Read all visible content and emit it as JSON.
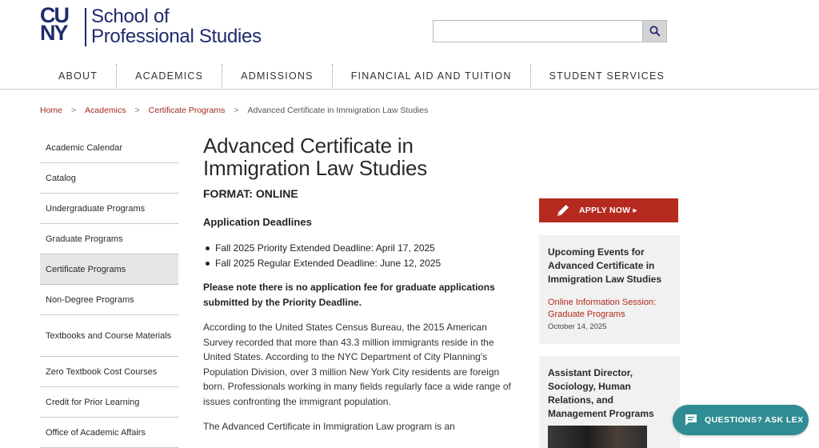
{
  "logo": {
    "mark_line1": "CU",
    "mark_line2": "NY",
    "text_line1": "School of",
    "text_line2": "Professional Studies"
  },
  "search": {
    "placeholder": "",
    "button_icon": "search-icon"
  },
  "nav": {
    "items": [
      "ABOUT",
      "ACADEMICS",
      "ADMISSIONS",
      "FINANCIAL AID AND TUITION",
      "STUDENT SERVICES"
    ]
  },
  "breadcrumb": {
    "items": [
      "Home",
      "Academics",
      "Certificate Programs"
    ],
    "current": "Advanced Certificate in Immigration Law Studies",
    "separator": ">"
  },
  "sidebar": {
    "items": [
      "Academic Calendar",
      "Catalog",
      "Undergraduate Programs",
      "Graduate Programs",
      "Certificate Programs",
      "Non-Degree Programs",
      "Textbooks and Course Materials",
      "Zero Textbook Cost Courses",
      "Credit for Prior Learning",
      "Office of Academic Affairs"
    ],
    "active_index": 4
  },
  "main": {
    "title": "Advanced Certificate in Immigration Law Studies",
    "format": "FORMAT: ONLINE",
    "deadlines_heading": "Application Deadlines",
    "deadlines": [
      "Fall 2025 Priority Extended Deadline: April 17, 2025",
      "Fall 2025 Regular Extended Deadline: June 12, 2025"
    ],
    "note": "Please note there is no application fee for graduate applications submitted by the Priority Deadline.",
    "paragraph1": "According to the United States Census Bureau, the 2015 American Survey recorded that more than 43.3 million immigrants reside in the United States. According to the NYC Department of City Planning's Population Division, over 3 million New York City residents are foreign born. Professionals working in many fields regularly face a wide range of issues confronting the immigrant population.",
    "paragraph2": "The Advanced Certificate in Immigration Law program is an"
  },
  "apply": {
    "label": "APPLY NOW ▸",
    "icon": "pencil-icon"
  },
  "events": {
    "title": "Upcoming Events for Advanced Certificate in Immigration Law Studies",
    "link": "Online Information Session: Graduate Programs",
    "date": "October 14, 2025"
  },
  "staff": {
    "title": "Assistant Director, Sociology, Human Relations, and Management Programs"
  },
  "chat": {
    "label": "QUESTIONS? ASK LEX",
    "icon": "chat-icon"
  },
  "colors": {
    "brand_navy": "#1f2a6b",
    "accent_red": "#b52a1e",
    "chat_teal": "#2f8c92"
  }
}
